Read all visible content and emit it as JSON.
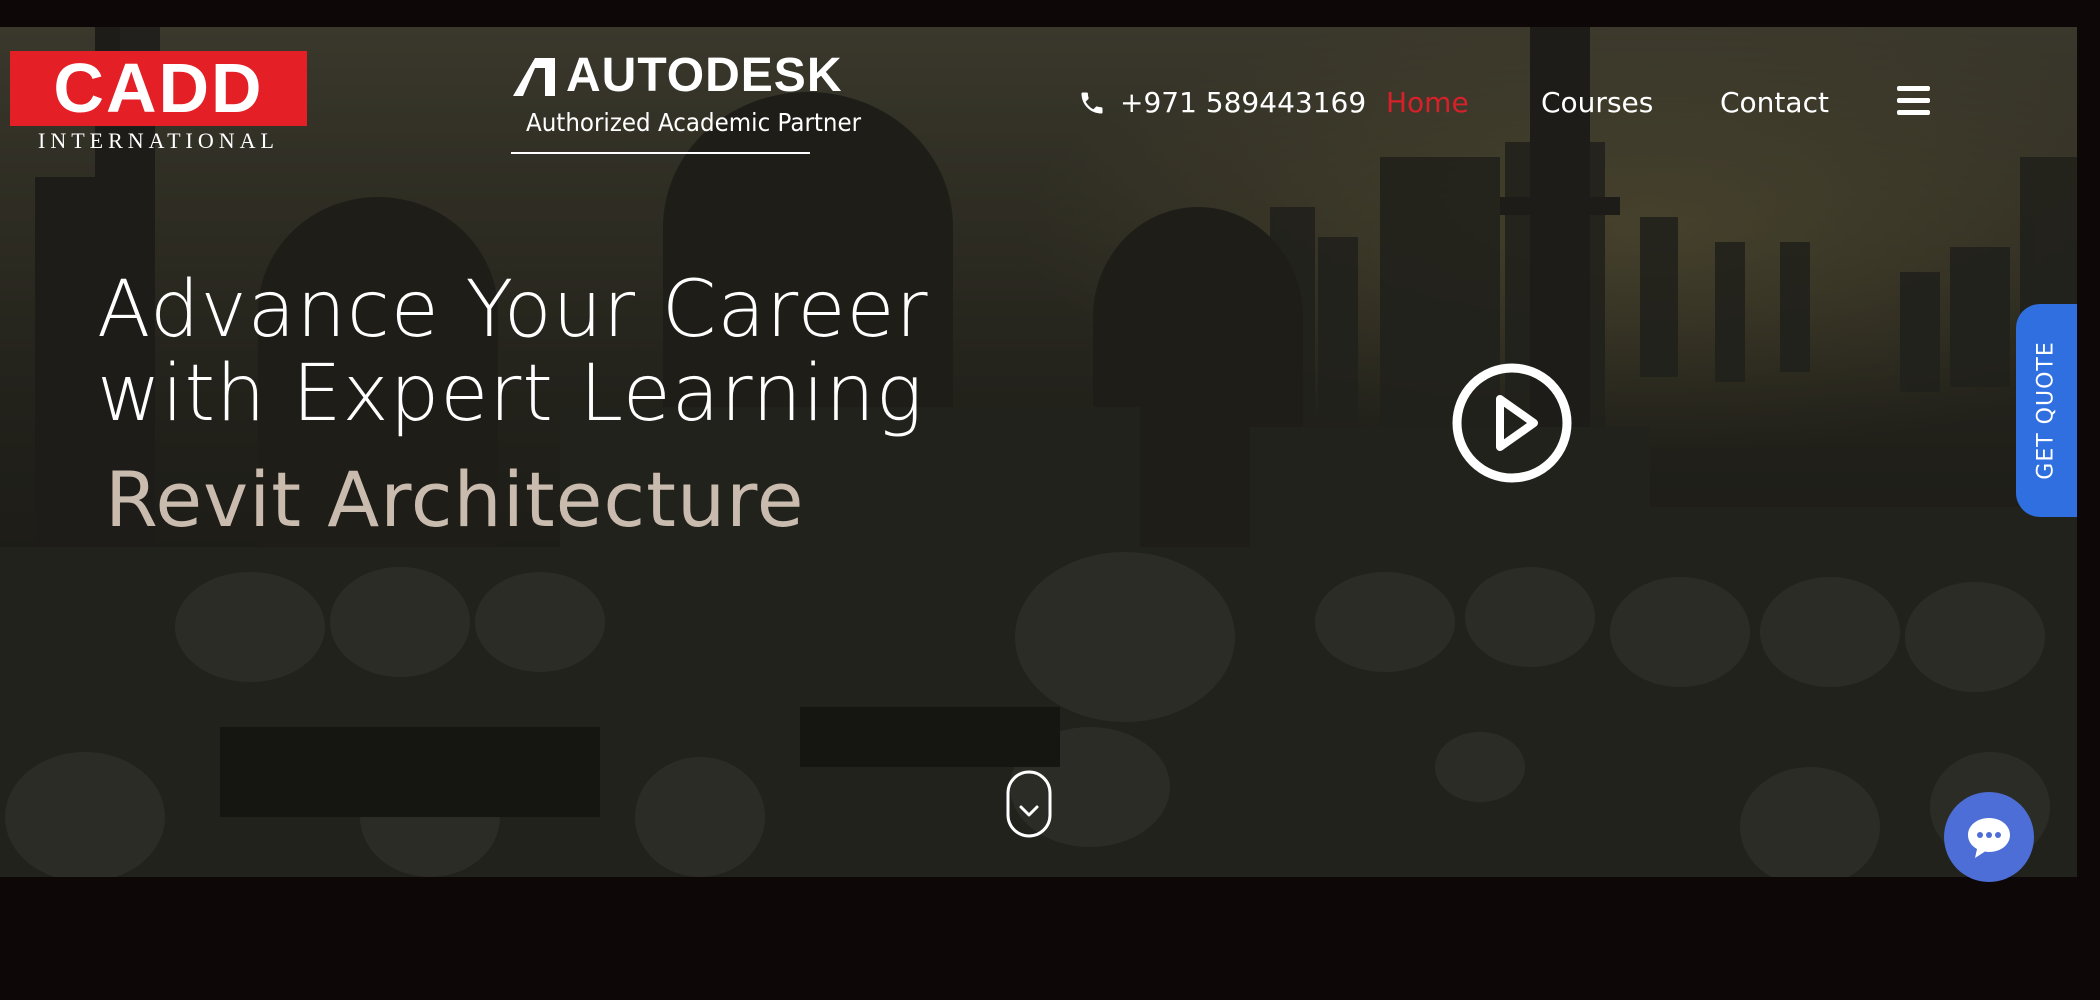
{
  "header": {
    "logo": {
      "brand": "CADD",
      "tagline": "INTERNATIONAL"
    },
    "partner": {
      "name": "AUTODESK",
      "subtitle": "Authorized Academic Partner"
    },
    "phone": {
      "icon": "phone-icon",
      "number": "+971 589443169"
    },
    "nav": {
      "items": [
        {
          "label": "Home",
          "active": true,
          "color": "#d8202a"
        },
        {
          "label": "Courses",
          "active": false
        },
        {
          "label": "Contact",
          "active": false
        }
      ],
      "menu_icon": "hamburger-menu-icon"
    }
  },
  "hero": {
    "headline_line1": "Advance Your Career",
    "headline_line2": "with Expert Learning",
    "subheading": "Revit Architecture",
    "play_icon": "play-icon",
    "scroll_icon": "chevron-down-icon"
  },
  "floating": {
    "quote_label": "GET QUOTE",
    "quote_color": "#2f6fe0",
    "chat_icon": "chat-bubble-icon",
    "chat_color": "#4c6ed6"
  },
  "colors": {
    "brand_red": "#e41f26",
    "page_bg": "#0d0807"
  }
}
